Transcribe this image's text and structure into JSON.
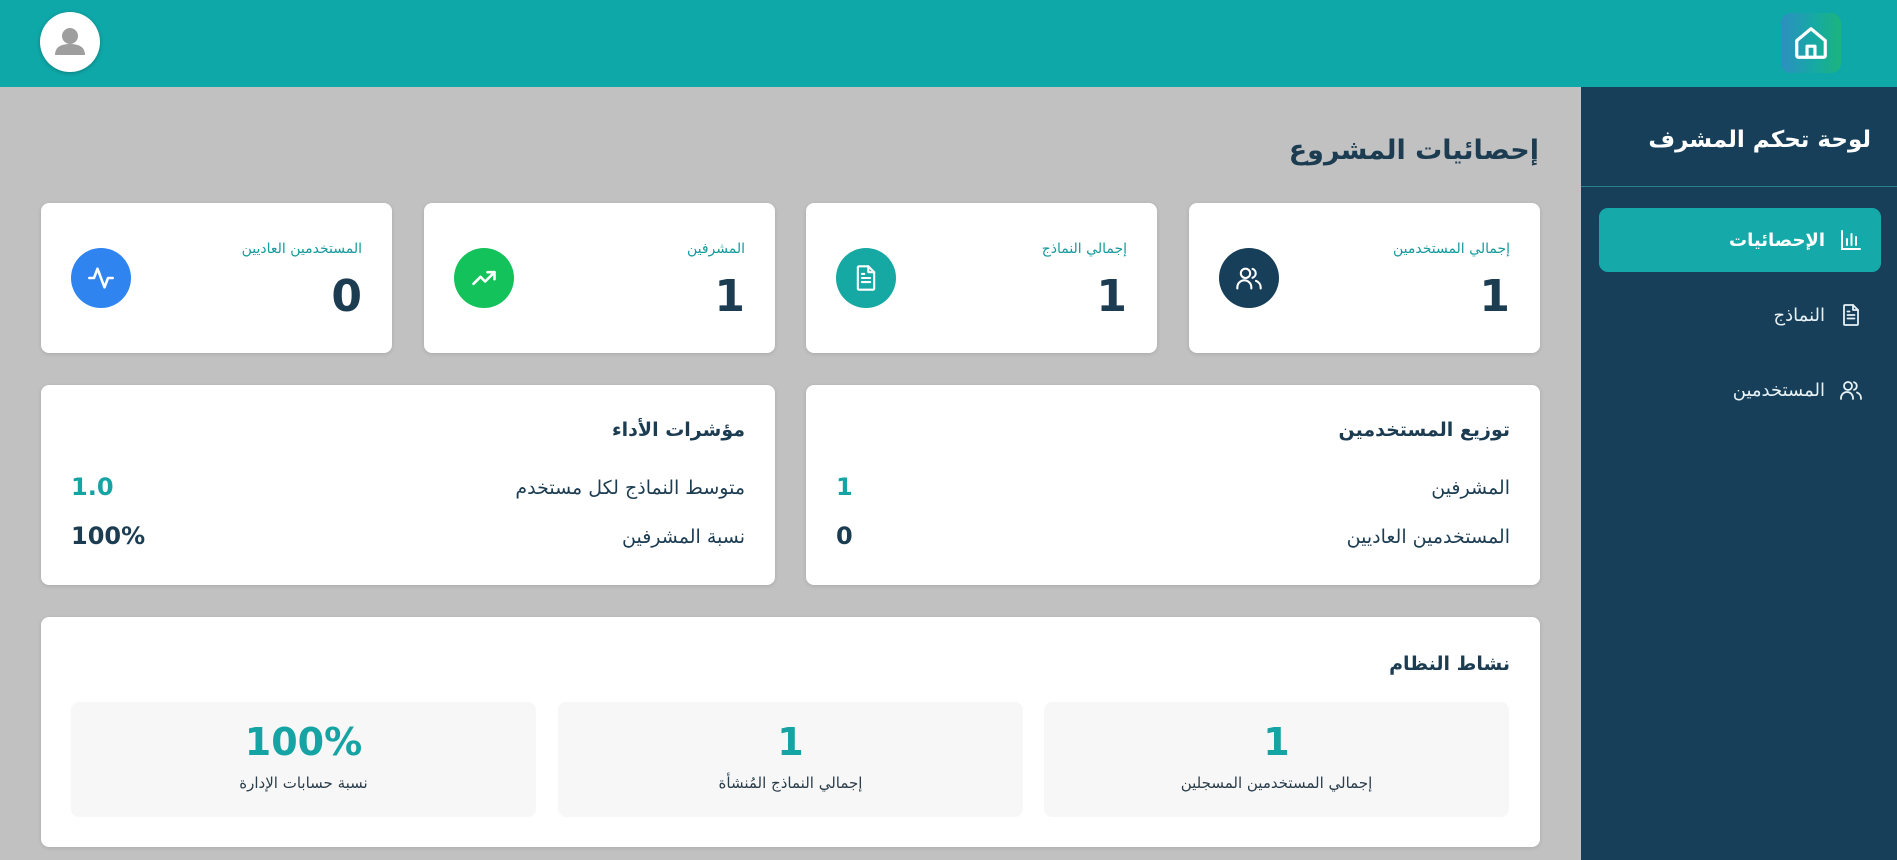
{
  "sidebar": {
    "title": "لوحة تحكم المشرف",
    "items": [
      {
        "label": "الإحصائيات",
        "icon": "bar-chart-icon",
        "active": true
      },
      {
        "label": "النماذج",
        "icon": "file-icon",
        "active": false
      },
      {
        "label": "المستخدمين",
        "icon": "users-icon",
        "active": false
      }
    ]
  },
  "main": {
    "title": "إحصائيات المشروع",
    "stats": [
      {
        "label": "إجمالي المستخدمين",
        "value": "1",
        "icon": "users-icon",
        "color": "#173f59"
      },
      {
        "label": "إجمالي النماذج",
        "value": "1",
        "icon": "file-icon",
        "color": "#16a9a4"
      },
      {
        "label": "المشرفين",
        "value": "1",
        "icon": "trending-up-icon",
        "color": "#13c25a"
      },
      {
        "label": "المستخدمين العاديين",
        "value": "0",
        "icon": "activity-icon",
        "color": "#2f84f0"
      }
    ],
    "distribution": {
      "title": "توزيع المستخدمين",
      "rows": [
        {
          "label": "المشرفين",
          "value": "1"
        },
        {
          "label": "المستخدمين العاديين",
          "value": "0"
        }
      ]
    },
    "performance": {
      "title": "مؤشرات الأداء",
      "rows": [
        {
          "label": "متوسط النماذج لكل مستخدم",
          "value": "1.0"
        },
        {
          "label": "نسبة المشرفين",
          "value": "100%"
        }
      ]
    },
    "activity": {
      "title": "نشاط النظام",
      "tiles": [
        {
          "value": "1",
          "label": "إجمالي المستخدمين المسجلين"
        },
        {
          "value": "1",
          "label": "إجمالي النماذج المُنشأة"
        },
        {
          "value": "100%",
          "label": "نسبة حسابات الإدارة"
        }
      ]
    }
  },
  "colors": {
    "topbar": "#0fa8a8",
    "sidebar": "#173f59",
    "accent": "#16a9a9",
    "text_dark": "#1c3c52"
  }
}
